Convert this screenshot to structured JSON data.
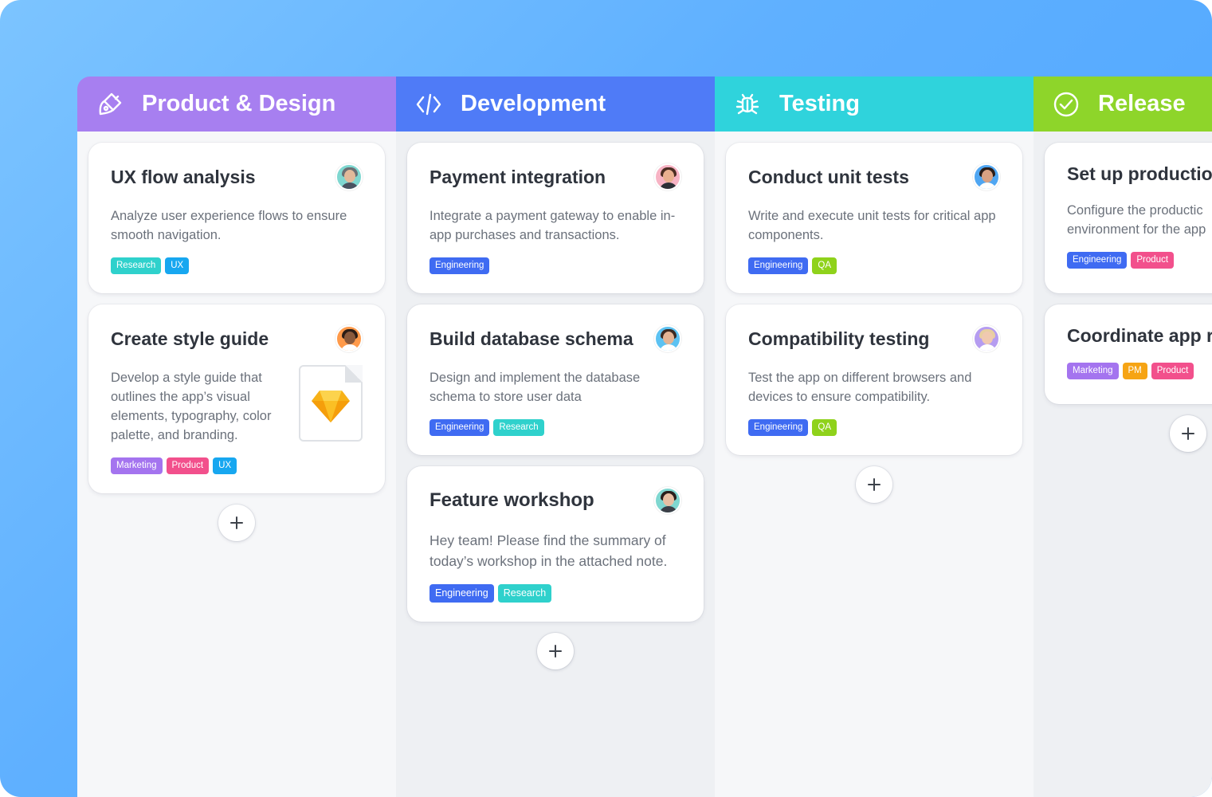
{
  "colors": {
    "product_design": "#a77ff0",
    "development": "#4f7bf7",
    "testing": "#2fd3dc",
    "release": "#8ed52a",
    "tag_research": "#2fd1cc",
    "tag_ux": "#17a7f0",
    "tag_engineering": "#3f6bf2",
    "tag_qa": "#8fd21b",
    "tag_product": "#f2508c",
    "tag_marketing": "#a474ef",
    "tag_pm": "#f6a414"
  },
  "columns": [
    {
      "title": "Product & Design",
      "icon": "paint-brush-icon",
      "cards": [
        {
          "title": "UX flow analysis",
          "description": "Analyze user experience flows to ensure smooth navigation.",
          "tags": [
            "Research",
            "UX"
          ]
        },
        {
          "title": "Create style guide",
          "description": "Develop a style guide that outlines the app’s visual elements, typography, color palette, and branding.",
          "attachment": "sketch-file-icon",
          "tags": [
            "Marketing",
            "Product",
            "UX"
          ]
        }
      ],
      "add_label": "+"
    },
    {
      "title": "Development",
      "icon": "code-icon",
      "cards": [
        {
          "title": "Payment integration",
          "description": "Integrate a payment gateway to enable in-app purchases and transactions.",
          "tags": [
            "Engineering"
          ]
        },
        {
          "title": "Build database schema",
          "description": "Design and implement the database schema to store user data",
          "tags": [
            "Engineering",
            "Research"
          ]
        },
        {
          "title": "Feature workshop",
          "description": "Hey team! Please find the summary of today’s workshop in the attached note.",
          "tags": [
            "Engineering",
            "Research"
          ]
        }
      ],
      "add_label": "+"
    },
    {
      "title": "Testing",
      "icon": "bug-icon",
      "cards": [
        {
          "title": "Conduct unit tests",
          "description": "Write and execute unit tests for critical app components.",
          "tags": [
            "Engineering",
            "QA"
          ]
        },
        {
          "title": "Compatibility testing",
          "description": "Test the app on different browsers and devices to ensure compatibility.",
          "tags": [
            "Engineering",
            "QA"
          ]
        }
      ],
      "add_label": "+"
    },
    {
      "title": "Release",
      "icon": "check-circle-icon",
      "cards": [
        {
          "title": "Set up productio",
          "description": "Configure the productic environment for the app",
          "tags": [
            "Engineering",
            "Product"
          ]
        },
        {
          "title": "Coordinate app r",
          "tags": [
            "Marketing",
            "PM",
            "Product"
          ]
        }
      ],
      "add_label": "+"
    }
  ]
}
